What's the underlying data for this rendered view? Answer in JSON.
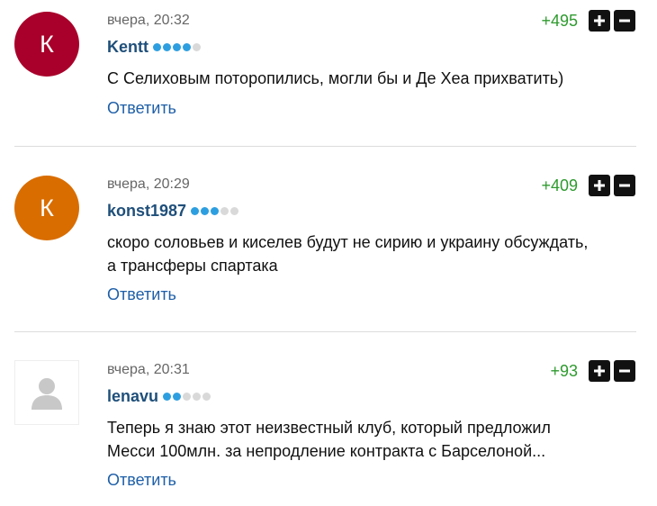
{
  "comments": [
    {
      "avatar_letter": "К",
      "avatar_color": "#a8002a",
      "time": "вчера, 20:32",
      "username": "Kentt",
      "rank": 4,
      "rating": "+495",
      "text": "С Селиховым поторопились, могли бы и Де Хеа прихватить)",
      "reply": "Ответить"
    },
    {
      "avatar_letter": "К",
      "avatar_color": "#d96d00",
      "time": "вчера, 20:29",
      "username": "konst1987",
      "rank": 3,
      "rating": "+409",
      "text": "скоро соловьев и киселев будут не сирию и украину обсуждать,\nа трансферы спартака",
      "reply": "Ответить"
    },
    {
      "avatar_letter": "",
      "avatar_color": "#ffffff",
      "time": "вчера, 20:31",
      "username": "lenavu",
      "rank": 2,
      "rating": "+93",
      "text": "Теперь я знаю этот неизвестный клуб, который предложил\nМесси 100млн. за непродление контракта с Барселоной...",
      "reply": "Ответить"
    }
  ]
}
